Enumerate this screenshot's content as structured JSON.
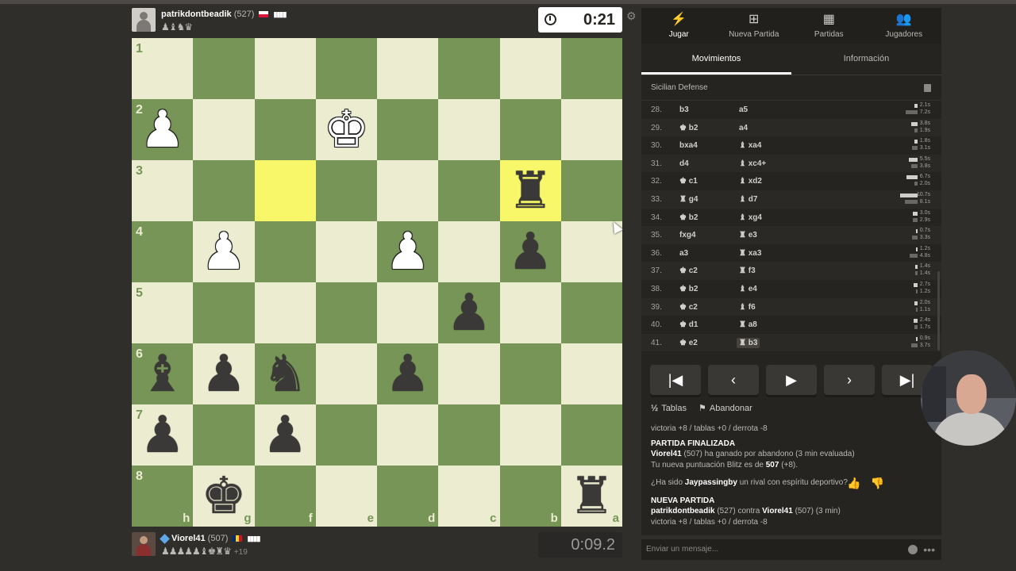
{
  "top_player": {
    "name": "patrikdontbeadik",
    "rating": "(527)",
    "bars": "▮▮▮▮",
    "captured": "♟♝♞♛"
  },
  "bottom_player": {
    "name": "Viorel41",
    "rating": "(507)",
    "bars": "▮▮▮▮",
    "captured": "♟♟♟♟♟♝♚♜♛",
    "captured_more": "+19"
  },
  "clocks": {
    "top": "0:21",
    "bottom": "0:09.2"
  },
  "board": {
    "rank_labels": [
      "1",
      "2",
      "3",
      "4",
      "5",
      "6",
      "7",
      "8"
    ],
    "file_labels": [
      "h",
      "g",
      "f",
      "e",
      "d",
      "c",
      "b",
      "a"
    ],
    "pieces": {
      "2-0": {
        "glyph": "♟",
        "color": "w"
      },
      "2-3": {
        "glyph": "♚",
        "color": "w"
      },
      "3-6": {
        "glyph": "♜",
        "color": "b"
      },
      "4-1": {
        "glyph": "♟",
        "color": "w"
      },
      "4-4": {
        "glyph": "♟",
        "color": "w"
      },
      "4-6": {
        "glyph": "♟",
        "color": "b"
      },
      "5-5": {
        "glyph": "♟",
        "color": "b"
      },
      "6-0": {
        "glyph": "♝",
        "color": "b"
      },
      "6-1": {
        "glyph": "♟",
        "color": "b"
      },
      "6-2": {
        "glyph": "♞",
        "color": "b"
      },
      "6-4": {
        "glyph": "♟",
        "color": "b"
      },
      "7-0": {
        "glyph": "♟",
        "color": "b"
      },
      "7-2": {
        "glyph": "♟",
        "color": "b"
      },
      "8-1": {
        "glyph": "♚",
        "color": "b"
      },
      "8-7": {
        "glyph": "♜",
        "color": "b"
      }
    },
    "highlights": [
      "3-2",
      "3-6"
    ]
  },
  "nav": [
    {
      "label": "Jugar",
      "icon": "lightning-icon",
      "glyph": "⚡"
    },
    {
      "label": "Nueva Partida",
      "icon": "plus-square-icon",
      "glyph": "⊞"
    },
    {
      "label": "Partidas",
      "icon": "board-icon",
      "glyph": "▦"
    },
    {
      "label": "Jugadores",
      "icon": "players-icon",
      "glyph": "👥"
    }
  ],
  "tabs": [
    "Movimientos",
    "Información"
  ],
  "opening": "Sicilian Defense",
  "moves": [
    {
      "n": "28.",
      "w": "b3",
      "b": "a5",
      "tw": "2.1s",
      "tb": "7.2s",
      "fw": 0.2,
      "fb": 0.7
    },
    {
      "n": "29.",
      "w": "♚ b2",
      "b": "a4",
      "tw": "3.8s",
      "tb": "1.9s",
      "fw": 0.35,
      "fb": 0.18
    },
    {
      "n": "30.",
      "w": "bxa4",
      "b": "♝ xa4",
      "tw": "1.8s",
      "tb": "3.1s",
      "fw": 0.17,
      "fb": 0.3
    },
    {
      "n": "31.",
      "w": "d4",
      "b": "♝ xc4+",
      "tw": "5.5s",
      "tb": "3.8s",
      "fw": 0.5,
      "fb": 0.35
    },
    {
      "n": "32.",
      "w": "♚ c1",
      "b": "♝ xd2",
      "tw": "6.7s",
      "tb": "2.0s",
      "fw": 0.62,
      "fb": 0.19
    },
    {
      "n": "33.",
      "w": "♜ g4",
      "b": "♝ d7",
      "tw": "10.7s",
      "tb": "8.1s",
      "fw": 1.0,
      "fb": 0.75
    },
    {
      "n": "34.",
      "w": "♚ b2",
      "b": "♝ xg4",
      "tw": "3.0s",
      "tb": "2.9s",
      "fw": 0.28,
      "fb": 0.27
    },
    {
      "n": "35.",
      "w": "fxg4",
      "b": "♜ e3",
      "tw": "0.7s",
      "tb": "3.3s",
      "fw": 0.07,
      "fb": 0.31
    },
    {
      "n": "36.",
      "w": "a3",
      "b": "♜ xa3",
      "tw": "1.2s",
      "tb": "4.8s",
      "fw": 0.11,
      "fb": 0.45
    },
    {
      "n": "37.",
      "w": "♚ c2",
      "b": "♜ f3",
      "tw": "1.4s",
      "tb": "1.4s",
      "fw": 0.13,
      "fb": 0.13
    },
    {
      "n": "38.",
      "w": "♚ b2",
      "b": "♝ e4",
      "tw": "2.7s",
      "tb": "1.2s",
      "fw": 0.25,
      "fb": 0.11
    },
    {
      "n": "39.",
      "w": "♚ c2",
      "b": "♝ f6",
      "tw": "2.0s",
      "tb": "1.1s",
      "fw": 0.19,
      "fb": 0.1
    },
    {
      "n": "40.",
      "w": "♚ d1",
      "b": "♜ a8",
      "tw": "2.4s",
      "tb": "1.7s",
      "fw": 0.22,
      "fb": 0.16
    },
    {
      "n": "41.",
      "w": "♚ e2",
      "b": "♜ b3",
      "tw": "0.9s",
      "tb": "3.7s",
      "fw": 0.08,
      "fb": 0.35
    }
  ],
  "controls": {
    "first": "|◀",
    "prev": "‹",
    "play": "▶",
    "next": "›",
    "last": "▶|"
  },
  "actions": {
    "draw": "Tablas",
    "draw_icon": "½",
    "resign": "Abandonar",
    "resign_icon": "⚑"
  },
  "chat": {
    "line1": "victoria +8 / tablas +0 / derrota -8",
    "finished": "PARTIDA FINALIZADA",
    "winner": "Viorel41",
    "winner_rest": " (507) ha ganado por abandono (3 min evaluada)",
    "rating_prefix": "Tu nueva puntuación Blitz es de ",
    "rating_value": "507",
    "rating_suffix": " (+8).",
    "sport_prefix": "¿Ha sido ",
    "sport_name": "Jaypassingby",
    "sport_suffix": " un rival con espíritu deportivo?",
    "new_game": "NUEVA PARTIDA",
    "ng_white": "patrikdontbeadik",
    "ng_mid": " (527) contra ",
    "ng_black": "Viorel41",
    "ng_end": " (507) (3 min)",
    "line_last": "victoria +8 / tablas +0 / derrota -8"
  },
  "message_placeholder": "Enviar un mensaje...",
  "colors": {
    "light_square": "#ebecd0",
    "dark_square": "#779556",
    "highlight": "#f7f769",
    "background": "#302e2b"
  }
}
